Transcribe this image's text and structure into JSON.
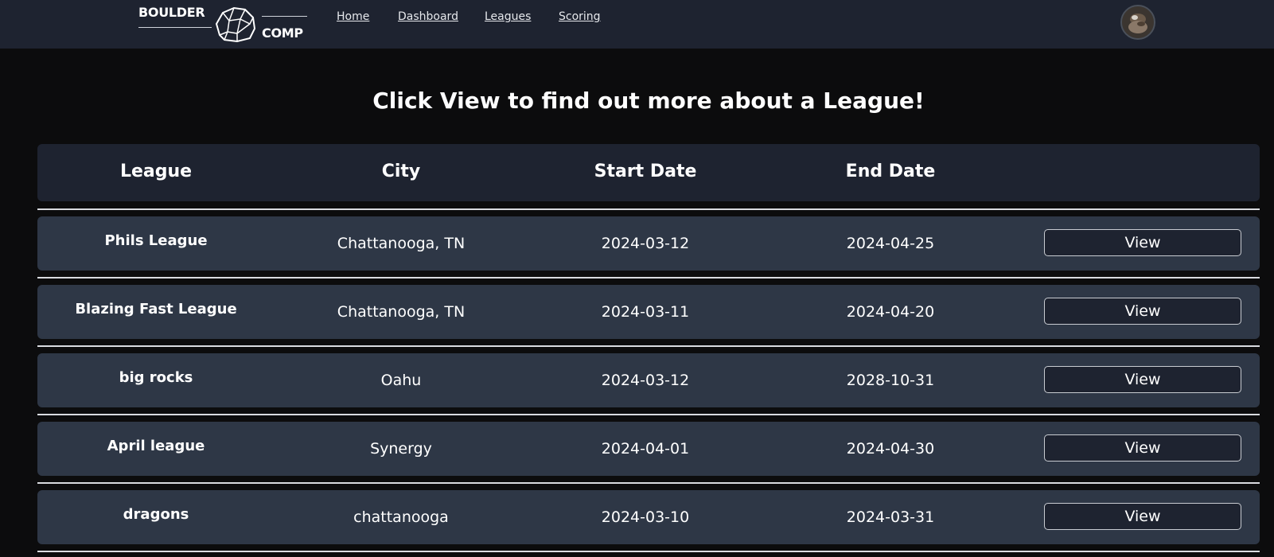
{
  "brand": {
    "top": "BOULDER",
    "bottom": "COMP"
  },
  "nav": {
    "links": [
      "Home",
      "Dashboard",
      "Leagues",
      "Scoring"
    ]
  },
  "page": {
    "title": "Click View to find out more about a League!"
  },
  "table": {
    "headers": [
      "League",
      "City",
      "Start Date",
      "End Date",
      ""
    ],
    "rows": [
      {
        "league": "Phils League",
        "city": "Chattanooga, TN",
        "start": "2024-03-12",
        "end": "2024-04-25",
        "action": "View"
      },
      {
        "league": "Blazing Fast League",
        "city": "Chattanooga, TN",
        "start": "2024-03-11",
        "end": "2024-04-20",
        "action": "View"
      },
      {
        "league": "big rocks",
        "city": "Oahu",
        "start": "2024-03-12",
        "end": "2028-10-31",
        "action": "View"
      },
      {
        "league": "April league",
        "city": "Synergy",
        "start": "2024-04-01",
        "end": "2024-04-30",
        "action": "View"
      },
      {
        "league": "dragons",
        "city": "chattanooga",
        "start": "2024-03-10",
        "end": "2024-03-31",
        "action": "View"
      }
    ]
  },
  "colors": {
    "background": "#0c0c0d",
    "navbar": "#1e2330",
    "header_row": "#1e2330",
    "data_row": "#2e3746",
    "button": "#1e2330",
    "text": "#ffffff"
  },
  "icons": {
    "logo": "boulder-rock-icon",
    "avatar": "user-avatar"
  }
}
